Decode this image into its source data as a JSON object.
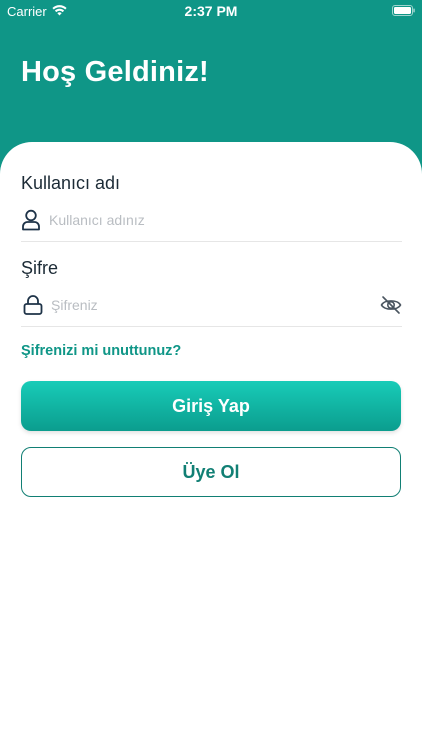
{
  "status_bar": {
    "carrier": "Carrier",
    "time": "2:37 PM"
  },
  "header": {
    "title": "Hoş Geldiniz!"
  },
  "form": {
    "username": {
      "label": "Kullanıcı adı",
      "placeholder": "Kullanıcı adınız",
      "icon": "user-icon"
    },
    "password": {
      "label": "Şifre",
      "placeholder": "Şifreniz",
      "icon": "lock-icon",
      "toggle_icon": "eye-slash-icon"
    },
    "forgot_password": "Şifrenizi mi unuttunuz?",
    "login_button": "Giriş Yap",
    "register_button": "Üye Ol"
  },
  "colors": {
    "primary": "#0f9687",
    "button_gradient_top": "#18ccb8",
    "button_gradient_bottom": "#0b9d8e",
    "outline": "#117f74"
  }
}
